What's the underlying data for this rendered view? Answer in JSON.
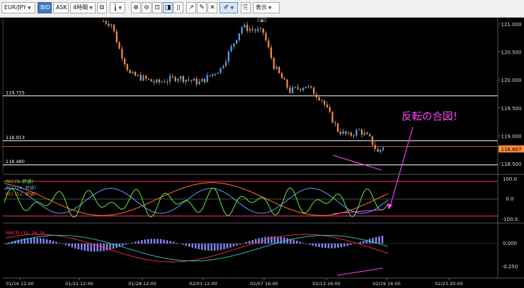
{
  "toolbar": {
    "symbol": "EUR/JPY",
    "bid": "BID",
    "ask": "ASK",
    "timeframe": "4時間",
    "display": "表示"
  },
  "price_axis": {
    "ticks": [
      "121.000",
      "120.500",
      "120.000",
      "119.500",
      "119.000",
      "118.500"
    ],
    "current_price": "118.807"
  },
  "levels": [
    "119.715",
    "118.913",
    "118.480"
  ],
  "rci": {
    "legend": [
      "RCI (9, 終値)",
      "RCI (26, 終値)",
      "RCI (52, 終値)"
    ],
    "colors": [
      "#66ee33",
      "#5aa0ff",
      "#ff7722"
    ],
    "ticks": [
      "100.0",
      "0.0",
      "-100.0"
    ]
  },
  "macd": {
    "legend": "MACD (12, 26, 9)",
    "ticks": [
      "0.000",
      "-0.250"
    ]
  },
  "annotation": "反転の合図！",
  "chart_data": {
    "type": "candlestick",
    "x_ticks": [
      "01/16 12:00",
      "01/22 12:00",
      "01/28 12:00",
      "02/03 12:00",
      "02/07 16:00",
      "02/13 16:00",
      "02/19 16:00",
      "02/23 20:00"
    ],
    "y_range": [
      118.4,
      121.05
    ],
    "price_line_keypoints": [
      {
        "bar": 0,
        "price": 121.05
      },
      {
        "bar": 3,
        "price": 121.0
      },
      {
        "bar": 6,
        "price": 120.55
      },
      {
        "bar": 10,
        "price": 120.1
      },
      {
        "bar": 20,
        "price": 119.95
      },
      {
        "bar": 28,
        "price": 120.05
      },
      {
        "bar": 36,
        "price": 119.95
      },
      {
        "bar": 44,
        "price": 120.2
      },
      {
        "bar": 52,
        "price": 120.95
      },
      {
        "bar": 60,
        "price": 120.85
      },
      {
        "bar": 64,
        "price": 120.25
      },
      {
        "bar": 70,
        "price": 119.8
      },
      {
        "bar": 76,
        "price": 119.9
      },
      {
        "bar": 82,
        "price": 119.65
      },
      {
        "bar": 88,
        "price": 119.1
      },
      {
        "bar": 92,
        "price": 119.0
      },
      {
        "bar": 96,
        "price": 119.1
      },
      {
        "bar": 100,
        "price": 118.95
      },
      {
        "bar": 103,
        "price": 118.7
      },
      {
        "bar": 105,
        "price": 118.81
      }
    ],
    "horizontal_levels": [
      119.715,
      118.913,
      118.48
    ],
    "current_price": 118.807
  },
  "colors": {
    "background": "#000000",
    "bull": "#4aa3ff",
    "bear": "#ff8a3a",
    "level_line": "#ffffff",
    "price_line": "#ff8a3a",
    "annotation": "#ff44ff",
    "rci_band": "#ff3366",
    "histogram": "#8888ff"
  }
}
